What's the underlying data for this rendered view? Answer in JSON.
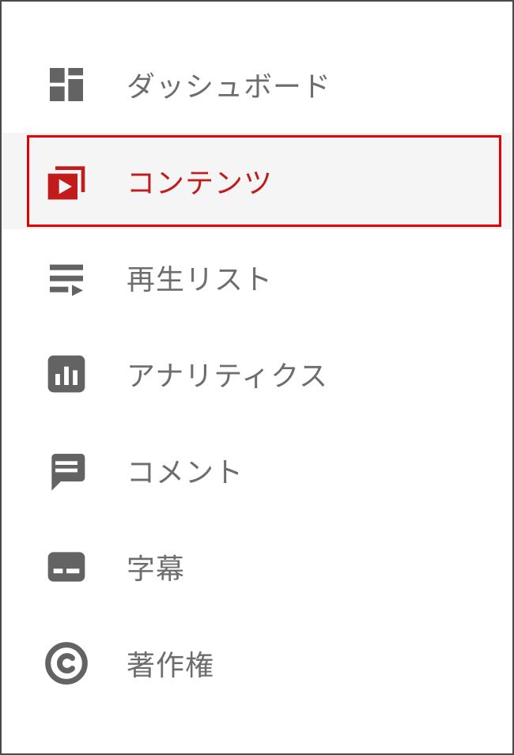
{
  "sidebar": {
    "items": [
      {
        "icon": "dashboard-icon",
        "label": "ダッシュボード",
        "selected": false
      },
      {
        "icon": "content-icon",
        "label": "コンテンツ",
        "selected": true
      },
      {
        "icon": "playlist-icon",
        "label": "再生リスト",
        "selected": false
      },
      {
        "icon": "analytics-icon",
        "label": "アナリティクス",
        "selected": false
      },
      {
        "icon": "comments-icon",
        "label": "コメント",
        "selected": false
      },
      {
        "icon": "subtitles-icon",
        "label": "字幕",
        "selected": false
      },
      {
        "icon": "copyright-icon",
        "label": "著作権",
        "selected": false
      }
    ]
  },
  "colors": {
    "accent": "#c11b1b",
    "highlight_border": "#e60000",
    "icon_default": "#636363",
    "text_default": "#6d6d6d",
    "selected_bg": "#f5f5f5"
  }
}
